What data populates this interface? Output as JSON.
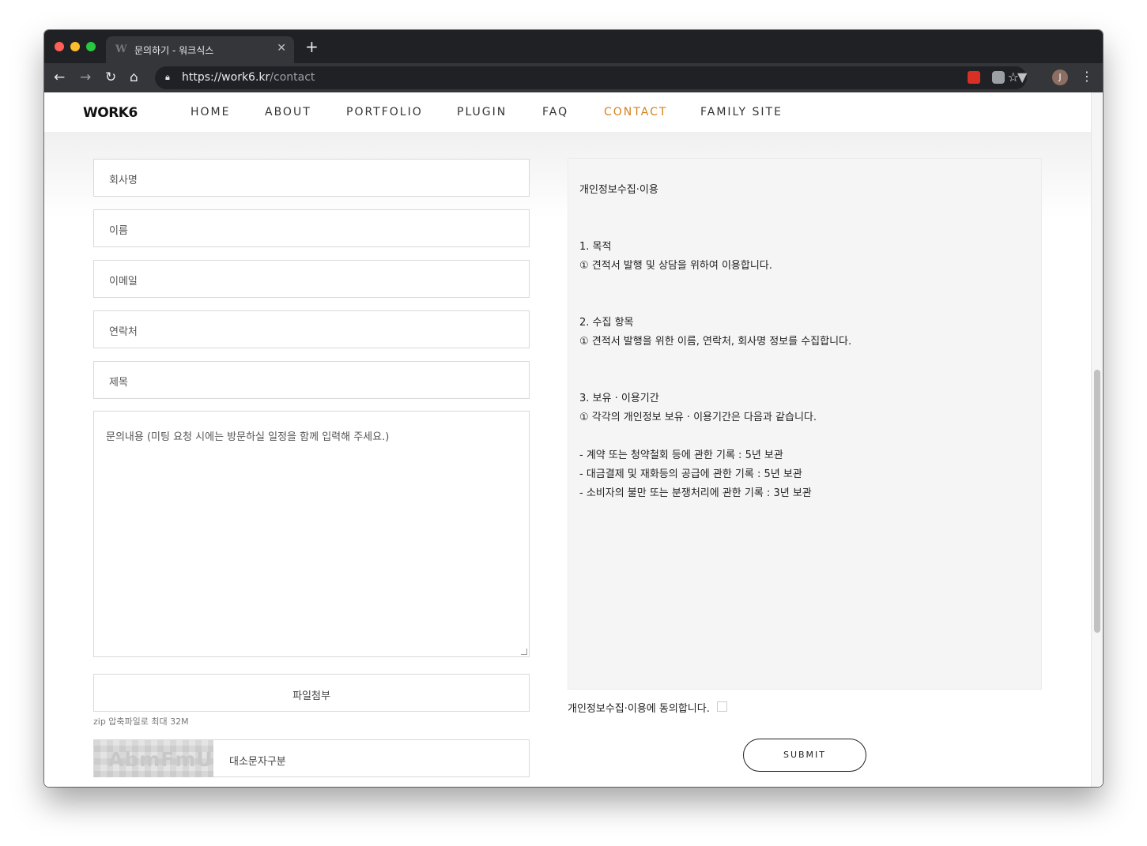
{
  "browser": {
    "tab_title": "문의하기 - 워크식스",
    "tab_favicon": "W",
    "tab_close": "✕",
    "new_tab": "+",
    "url_host": "https://work6.kr",
    "url_path": "/contact",
    "avatar_initial": "J",
    "icons": [
      "back-arrow-icon",
      "forward-arrow-icon",
      "reload-icon",
      "home-icon",
      "lock-icon",
      "star-icon",
      "extension-icon",
      "camera-icon",
      "vimeo-icon",
      "menu-dots-icon"
    ]
  },
  "site": {
    "logo": "WORK6",
    "nav": [
      {
        "label": "HOME"
      },
      {
        "label": "ABOUT"
      },
      {
        "label": "PORTFOLIO"
      },
      {
        "label": "PLUGIN"
      },
      {
        "label": "FAQ"
      },
      {
        "label": "CONTACT",
        "active": true
      },
      {
        "label": "FAMILY SITE"
      }
    ],
    "accent_color": "#d4821e"
  },
  "form": {
    "company_placeholder": "회사명",
    "name_placeholder": "이름",
    "email_placeholder": "이메일",
    "phone_placeholder": "연락처",
    "subject_placeholder": "제목",
    "message_placeholder": "문의내용 (미팅 요청 시에는 방문하실 일정을 함께 입력해 주세요.)",
    "file_label": "파일첨부",
    "file_hint": "zip 압축파일로 최대 32M",
    "captcha_text": "AbmFmU",
    "captcha_placeholder": "대소문자구분"
  },
  "privacy": {
    "title": "개인정보수집·이용",
    "s1_heading": "1. 목적",
    "s1_body": "① 견적서 발행 및 상담을 위하여 이용합니다.",
    "s2_heading": "2. 수집 항목",
    "s2_body": "① 견적서 발행을 위한 이름, 연락처, 회사명 정보를 수집합니다.",
    "s3_heading": "3. 보유 · 이용기간",
    "s3_body": "① 각각의 개인정보 보유 · 이용기간은 다음과 같습니다.",
    "s3_item1": "- 계약 또는 청약철회 등에 관한 기록 : 5년 보관",
    "s3_item2": "- 대금결제 및 재화등의 공급에 관한 기록 : 5년 보관",
    "s3_item3": "- 소비자의 불만 또는 분쟁처리에 관한 기록 : 3년 보관",
    "agree_label": "개인정보수집·이용에 동의합니다.",
    "agreed": false,
    "submit_label": "SUBMIT"
  }
}
